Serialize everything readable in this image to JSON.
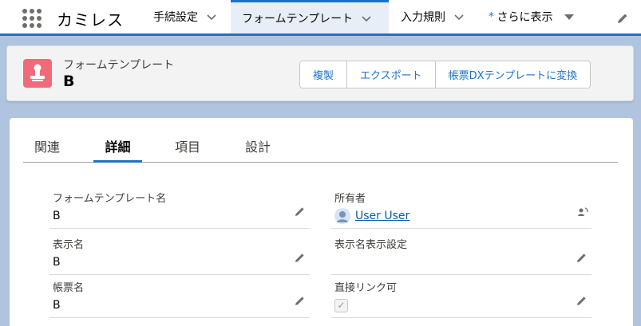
{
  "app": {
    "name": "カミレス"
  },
  "nav": {
    "items": [
      {
        "label": "手続設定"
      },
      {
        "label": "フォームテンプレート"
      },
      {
        "label": "入力規則"
      }
    ],
    "more": {
      "marker": "*",
      "label": "さらに表示"
    }
  },
  "record": {
    "type": "フォームテンプレート",
    "name": "B",
    "actions": [
      "複製",
      "エクスポート",
      "帳票DXテンプレートに変換"
    ]
  },
  "tabs": [
    "関連",
    "詳細",
    "項目",
    "設計"
  ],
  "active_tab": "詳細",
  "fields": {
    "template_name": {
      "label": "フォームテンプレート名",
      "value": "B"
    },
    "owner": {
      "label": "所有者",
      "value": "User User"
    },
    "display_name": {
      "label": "表示名",
      "value": "B"
    },
    "display_name_setting": {
      "label": "表示名表示設定",
      "value": ""
    },
    "form_name": {
      "label": "帳票名",
      "value": "B"
    },
    "direct_link": {
      "label": "直接リンク可",
      "value": "✓"
    }
  },
  "colors": {
    "brand_blue": "#1b73c9",
    "object_icon": "#f26979",
    "background": "#b0c4df"
  },
  "icons": {
    "app_launcher": "waffle-icon",
    "object": "form-template-icon",
    "edit": "pencil-icon",
    "change_owner": "change-owner-icon",
    "avatar": "user-avatar-icon"
  }
}
